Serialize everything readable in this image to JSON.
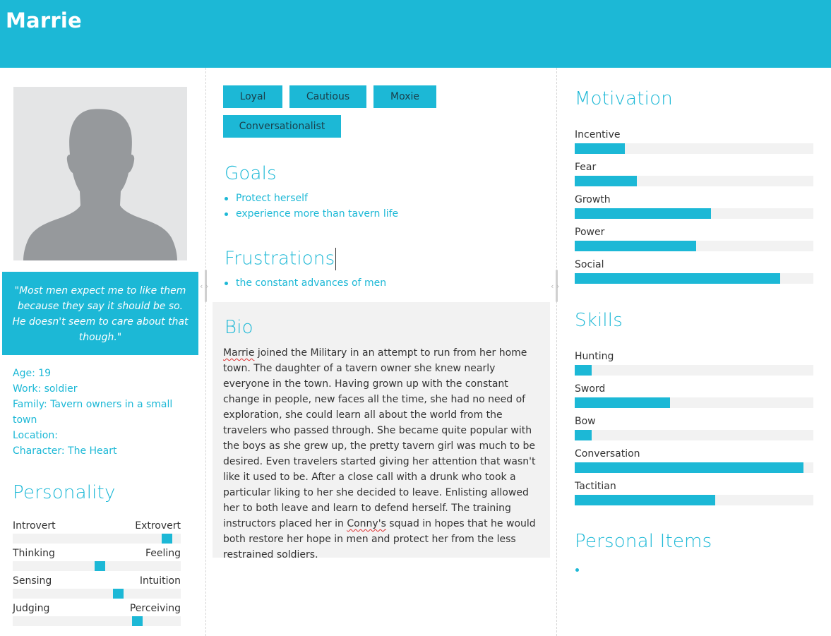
{
  "header": {
    "name": "Marrie"
  },
  "profile": {
    "quote": "\"Most men expect me to like them because they say it should be so. He doesn't seem to care about that though.\"",
    "facts": [
      "Age: 19",
      "Work: soldier",
      "Family: Tavern owners in a small town",
      "Location:",
      "Character: The Heart"
    ]
  },
  "personality": {
    "title": "Personality",
    "traits": [
      {
        "left": "Introvert",
        "right": "Extrovert",
        "value": 0.92
      },
      {
        "left": "Thinking",
        "right": "Feeling",
        "value": 0.52
      },
      {
        "left": "Sensing",
        "right": "Intuition",
        "value": 0.63
      },
      {
        "left": "Judging",
        "right": "Perceiving",
        "value": 0.74
      }
    ]
  },
  "tags": [
    "Loyal",
    "Cautious",
    "Moxie",
    "Conversationalist"
  ],
  "goals": {
    "title": "Goals",
    "items": [
      "Protect herself",
      "experience more than tavern life"
    ]
  },
  "frustrations": {
    "title": "Frustrations",
    "items": [
      "the constant advances of men"
    ]
  },
  "bio": {
    "title": "Bio",
    "word_1": "Marrie",
    "text_1": " joined the Military in an attempt to run from her home town. The daughter of a tavern owner she knew nearly everyone in the town. Having grown up with the constant change in people, new faces all the time, she had no need of exploration, she could learn all about the world from the travelers who passed through. She became quite popular with the boys as she grew up, the pretty tavern girl was much to be desired. Even travelers started giving her attention that wasn't like it used to be. After a close call with a drunk who took a particular liking to her she decided to leave. Enlisting allowed her to both leave and learn to defend herself. The training instructors placed her in ",
    "word_2": "Conny's",
    "text_2": " squad in hopes that he would both restore her hope in men and protect her from the less restrained soldiers."
  },
  "motivation": {
    "title": "Motivation",
    "items": [
      {
        "label": "Incentive",
        "value": 0.21
      },
      {
        "label": "Fear",
        "value": 0.26
      },
      {
        "label": "Growth",
        "value": 0.57
      },
      {
        "label": "Power",
        "value": 0.51
      },
      {
        "label": "Social",
        "value": 0.86
      }
    ]
  },
  "skills": {
    "title": "Skills",
    "items": [
      {
        "label": "Hunting",
        "value": 0.07
      },
      {
        "label": "Sword",
        "value": 0.4
      },
      {
        "label": "Bow",
        "value": 0.07
      },
      {
        "label": "Conversation",
        "value": 0.96
      },
      {
        "label": "Tactitian",
        "value": 0.59
      }
    ]
  },
  "personal_items": {
    "title": "Personal Items"
  },
  "colors": {
    "accent": "#1cb8d6",
    "track": "#f2f2f2",
    "text": "#333333"
  }
}
